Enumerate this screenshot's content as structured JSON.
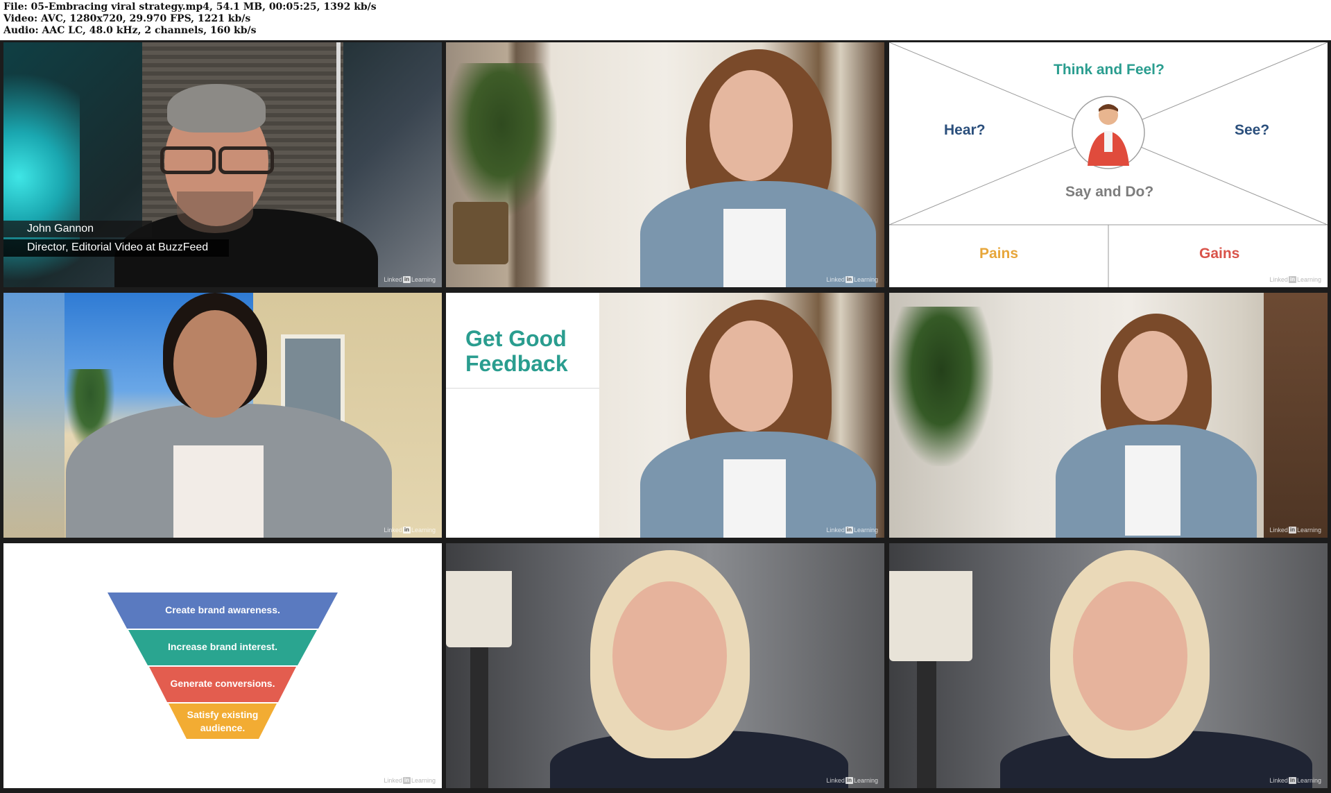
{
  "header": {
    "file_line": "File: 05-Embracing viral strategy.mp4, 54.1 MB, 00:05:25, 1392 kb/s",
    "video_line": "Video: AVC, 1280x720, 29.970 FPS, 1221 kb/s",
    "audio_line": "Audio: AAC LC, 48.0 kHz, 2 channels, 160 kb/s"
  },
  "watermark": {
    "brand": "Linked",
    "in": "in",
    "suffix": "Learning"
  },
  "lower_third": {
    "name": "John Gannon",
    "title": "Director, Editorial Video at BuzzFeed"
  },
  "empathy_map": {
    "think_feel": "Think and Feel?",
    "hear": "Hear?",
    "see": "See?",
    "say_do": "Say and Do?",
    "pains": "Pains",
    "gains": "Gains",
    "colors": {
      "teal": "#2a9d8f",
      "navy": "#2b4f7c",
      "gray": "#7d7d7d",
      "orange": "#e7a63a",
      "red": "#d9534a"
    }
  },
  "feedback_slide": {
    "line1": "Get Good",
    "line2": "Feedback"
  },
  "funnel": {
    "stages": [
      {
        "label": "Create brand awareness.",
        "color": "#5a7ac0"
      },
      {
        "label": "Increase brand interest.",
        "color": "#2aa590"
      },
      {
        "label": "Generate conversions.",
        "color": "#e35d4f"
      },
      {
        "label_line1": "Satisfy existing",
        "label_line2": "audience.",
        "color": "#f2ac33"
      }
    ]
  }
}
